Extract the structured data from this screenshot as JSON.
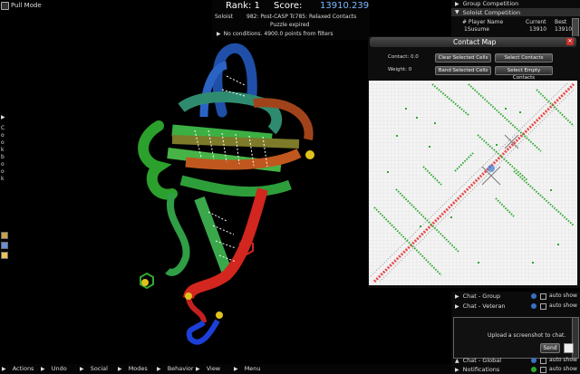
{
  "top_left": {
    "pull_mode_label": "Pull Mode"
  },
  "header": {
    "rank_label": "Rank: 1",
    "score_label": "Score:",
    "score_value": "13910.239",
    "mode": "Soloist",
    "puzzle_name": "982: Post-CASP Tc785: Relaxed Contacts",
    "puzzle_status": "Puzzle expired",
    "conditions": "No conditions. 4900.0 points from filters"
  },
  "cookbook": {
    "label": "Cookbook"
  },
  "competition": {
    "group_label": "Group Competition",
    "soloist_label": "Soloist Competition",
    "columns": [
      "# Player Name",
      "Current",
      "Best"
    ],
    "rows": [
      {
        "name": "1Susume",
        "current": "13910",
        "best": "13910"
      }
    ]
  },
  "contact_map": {
    "title": "Contact Map",
    "contact_label": "Contact: 0.0",
    "weight_label": "Weight: 0",
    "clear_selected": "Clear Selected Cells",
    "select_contacts": "Select Contacts",
    "band_selected": "Band Selected Cells",
    "select_empty": "Select Empty Contacts"
  },
  "chat": {
    "group_label": "Chat - Group",
    "veteran_label": "Chat - Veteran",
    "global_label": "Chat - Global",
    "notifications_label": "Notifications",
    "auto_show": "auto show",
    "upload_text": "Upload a screenshot to chat.",
    "send_label": "Send"
  },
  "bottom_menu": {
    "actions": "Actions",
    "undo": "Undo",
    "social": "Social",
    "modes": "Modes",
    "behavior": "Behavior",
    "view": "View",
    "menu": "Menu"
  },
  "colors": {
    "score": "#7ab8ff",
    "map_bg": "#f4f4f4",
    "contact_green": "#2fa82f",
    "diagonal_red": "#e84a4a",
    "panel_header": "#3a3a3a"
  }
}
